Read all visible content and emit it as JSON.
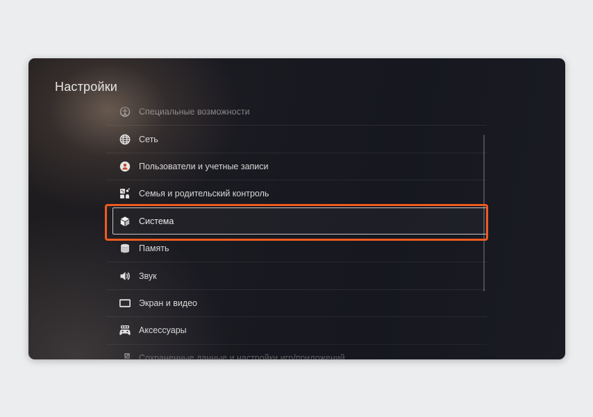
{
  "page": {
    "title": "Настройки"
  },
  "settings": {
    "items": [
      {
        "label": "Специальные возможности",
        "icon": "accessibility-icon"
      },
      {
        "label": "Сеть",
        "icon": "globe-icon"
      },
      {
        "label": "Пользователи и учетные записи",
        "icon": "user-icon"
      },
      {
        "label": "Семья и родительский контроль",
        "icon": "family-icon"
      },
      {
        "label": "Система",
        "icon": "cube-icon",
        "selected": true
      },
      {
        "label": "Память",
        "icon": "storage-icon"
      },
      {
        "label": "Звук",
        "icon": "speaker-icon"
      },
      {
        "label": "Экран и видео",
        "icon": "display-icon"
      },
      {
        "label": "Аксессуары",
        "icon": "controller-icon"
      },
      {
        "label": "Сохраненные данные и настройки игр/приложений",
        "icon": "saved-data-icon"
      }
    ]
  },
  "colors": {
    "highlight": "#f15a1f",
    "background": "#ebedee",
    "text": "#d9d9d9"
  }
}
